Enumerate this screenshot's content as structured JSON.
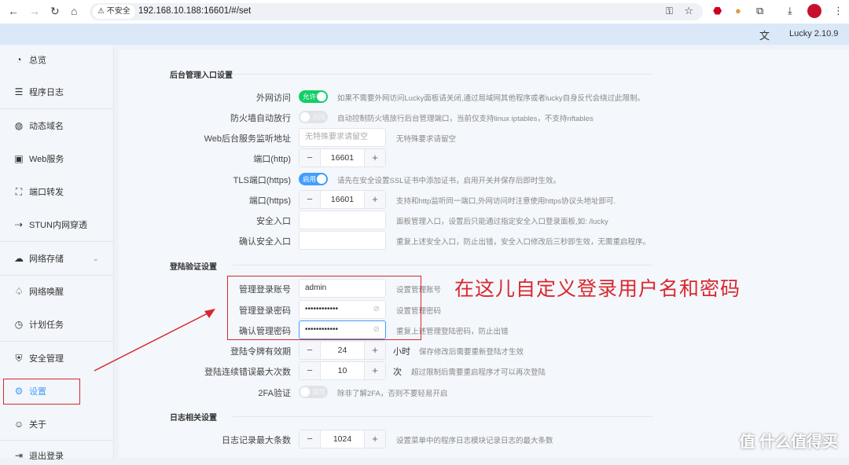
{
  "browser": {
    "security_label": "不安全",
    "url": "192.168.10.188:16601/#/set"
  },
  "header": {
    "version": "Lucky 2.10.9"
  },
  "sidebar": {
    "items": [
      {
        "label": "总览",
        "icon": "dashboard-icon"
      },
      {
        "label": "程序日志",
        "icon": "log-icon"
      },
      {
        "label": "动态域名",
        "icon": "dns-icon"
      },
      {
        "label": "Web服务",
        "icon": "web-icon"
      },
      {
        "label": "端口转发",
        "icon": "port-forward-icon"
      },
      {
        "label": "STUN内网穿透",
        "icon": "stun-icon"
      },
      {
        "label": "网络存储",
        "icon": "cloud-icon"
      },
      {
        "label": "网络唤醒",
        "icon": "bell-icon"
      },
      {
        "label": "计划任务",
        "icon": "clock-icon"
      },
      {
        "label": "安全管理",
        "icon": "shield-icon"
      },
      {
        "label": "设置",
        "icon": "gear-icon",
        "active": true
      },
      {
        "label": "关于",
        "icon": "about-icon"
      },
      {
        "label": "退出登录",
        "icon": "logout-icon"
      }
    ]
  },
  "sections": {
    "admin": {
      "title": "后台管理入口设置",
      "external_access": {
        "label": "外网访问",
        "toggle": "允许",
        "on": true,
        "hint": "如果不需要外网访问Lucky面板请关闭,通过局域网其他程序或者lucky自身反代会绕过此限制。"
      },
      "firewall": {
        "label": "防火墙自动放行",
        "toggle": "关闭",
        "on": false,
        "hint": "自动控制防火墙放行后台管理端口，当前仅支持linux iptables，不支持nftables"
      },
      "listen_addr": {
        "label": "Web后台服务监听地址",
        "placeholder": "无特殊要求请留空",
        "hint": "无特殊要求请留空"
      },
      "http_port": {
        "label": "端口(http)",
        "value": "16601"
      },
      "tls": {
        "label": "TLS端口(https)",
        "toggle": "启用",
        "on": true,
        "hint": "请先在安全设置SSL证书中添加证书，启用开关并保存后即时生效。"
      },
      "https_port": {
        "label": "端口(https)",
        "value": "16601",
        "hint": "支持和http监听同一端口,外网访问时注意使用https协议头地址即可."
      },
      "safe_entry": {
        "label": "安全入口",
        "value": "",
        "hint": "面板管理入口，设置后只能通过指定安全入口登录面板,如: /lucky"
      },
      "safe_entry_confirm": {
        "label": "确认安全入口",
        "value": "",
        "hint": "重复上述安全入口，防止出错，安全入口修改后三秒即生效，无需重启程序。"
      }
    },
    "login": {
      "title": "登陆验证设置",
      "account": {
        "label": "管理登录账号",
        "value": "admin",
        "hint": "设置管理账号"
      },
      "password": {
        "label": "管理登录密码",
        "value": "••••••••••••",
        "hint": "设置管理密码"
      },
      "password_confirm": {
        "label": "确认管理密码",
        "value": "••••••••••••",
        "hint": "重复上述管理登陆密码，防止出错"
      },
      "token_ttl": {
        "label": "登陆令牌有效期",
        "value": "24",
        "unit": "小时",
        "hint": "保存修改后需要重新登陆才生效"
      },
      "max_errors": {
        "label": "登陆连续错误最大次数",
        "value": "10",
        "unit": "次",
        "hint": "超过限制后需要重启程序才可以再次登陆"
      },
      "twofa": {
        "label": "2FA验证",
        "toggle": "禁用",
        "on": false,
        "hint": "除非了解2FA，否则不要轻易开启"
      }
    },
    "log": {
      "title": "日志相关设置",
      "max_entries": {
        "label": "日志记录最大条数",
        "value": "1024",
        "hint": "设置菜单中的程序日志模块记录日志的最大条数"
      }
    }
  },
  "annotation": {
    "text": "在这儿自定义登录用户名和密码"
  },
  "watermark": "值 什么值得买",
  "colors": {
    "accent": "#409eff",
    "switch_on_green": "#13ce66",
    "annotation_red": "#d7282f"
  }
}
